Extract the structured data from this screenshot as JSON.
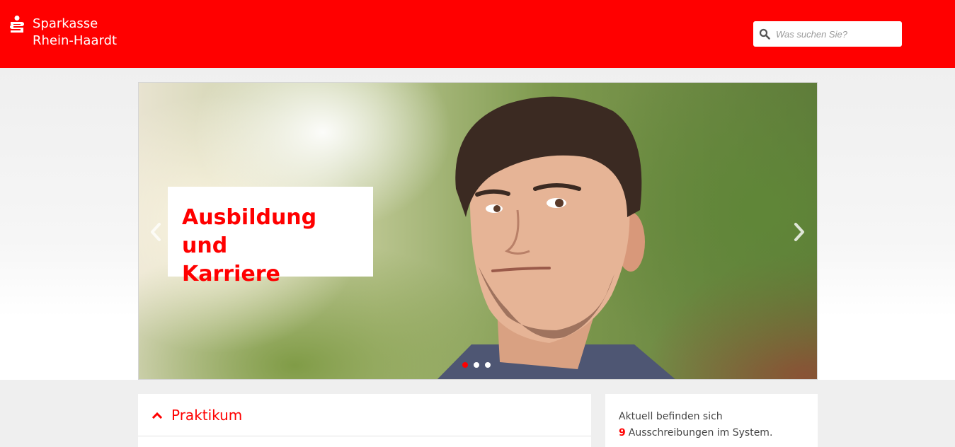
{
  "header": {
    "brand_line1": "Sparkasse",
    "brand_line2": "Rhein-Haardt",
    "brand_color": "#ff0000",
    "search_placeholder": "Was suchen Sie?",
    "search_icon": "search-icon"
  },
  "slider": {
    "caption_line1": "Ausbildung und",
    "caption_line2": "Karriere",
    "prev_icon": "chevron-left-icon",
    "next_icon": "chevron-right-icon",
    "dots": [
      {
        "active": true
      },
      {
        "active": false
      },
      {
        "active": false
      }
    ]
  },
  "accordion": {
    "title": "Praktikum",
    "expanded": true
  },
  "info": {
    "line1": "Aktuell befinden sich",
    "count": "9",
    "line2": "Ausschreibungen im System."
  }
}
